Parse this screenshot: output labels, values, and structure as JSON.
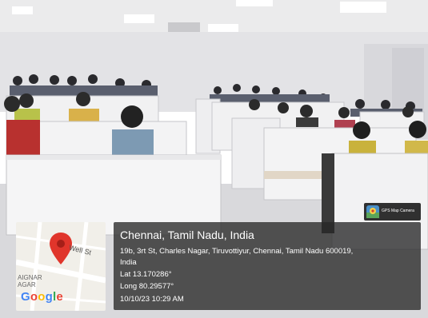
{
  "photo": {
    "subject": "Students seated at cubicle desks in a classroom",
    "colors": {
      "ceiling": "#ebebec",
      "wall": "#e3e3e6",
      "desk": "#f1f1f2",
      "floor": "#d9d9dc"
    }
  },
  "map": {
    "street_label": "Well St",
    "area_label_1": "AIGNAR",
    "area_label_2": "AGAR",
    "pin_icon": "map-pin-icon",
    "pin_color": "#e0352b",
    "logo_letters": [
      "G",
      "o",
      "o",
      "g",
      "l",
      "e"
    ],
    "logo_colors": [
      "#4285F4",
      "#EA4335",
      "#FBBC05",
      "#4285F4",
      "#34A853",
      "#EA4335"
    ]
  },
  "info": {
    "city": "Chennai, Tamil Nadu, India",
    "address_line_1": "19b, 3rt St, Charles Nagar, Tiruvottiyur, Chennai, Tamil Nadu 600019,",
    "address_line_2": "India",
    "latitude": "Lat 13.170286°",
    "longitude": "Long 80.29577°",
    "datetime": "10/10/23 10:29 AM"
  },
  "badge": {
    "label": "GPS Map Camera",
    "icon": "gps-map-camera-icon"
  }
}
